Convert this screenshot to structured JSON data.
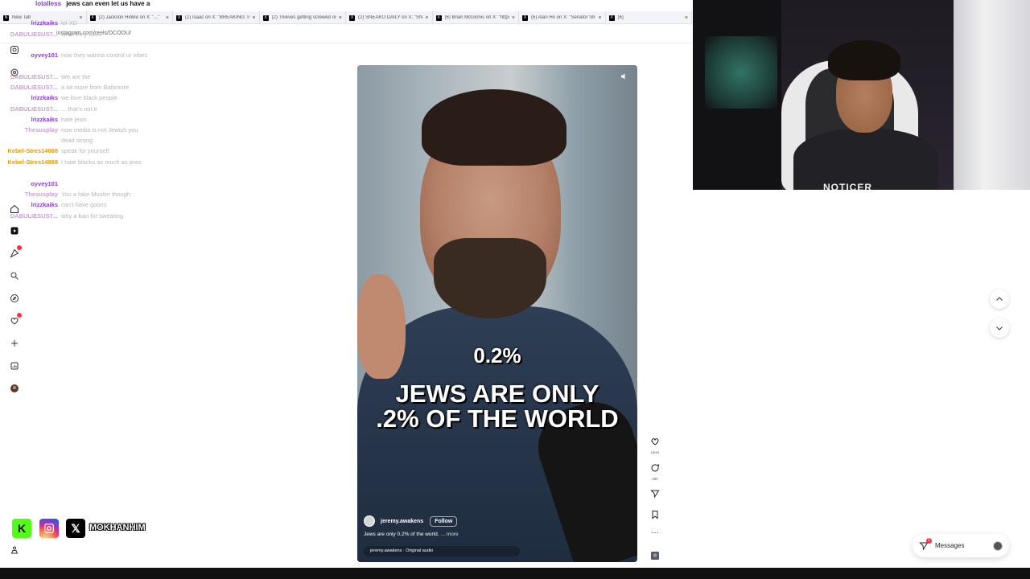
{
  "browser": {
    "tabs": [
      {
        "label": "New Tab",
        "icon": "N"
      },
      {
        "label": "(2) Jackson Hinkle on X: \"...\"",
        "icon": "X"
      },
      {
        "label": "(2) Isaac on X: \"BREAKING: Isra...",
        "icon": "X"
      },
      {
        "label": "(2) Thieves getting screwed on...",
        "icon": "X"
      },
      {
        "label": "(2) SNEAKO DAILY on X: \"SNEA...",
        "icon": "X"
      },
      {
        "label": "(6) Brian McGinnis on X: \"https...",
        "icon": "X"
      },
      {
        "label": "(6) Alan Ho on X: \"Senator Shed...",
        "icon": "X"
      },
      {
        "label": "(6)",
        "icon": "X"
      }
    ],
    "address": "instagram.com/reels/DCOOU/"
  },
  "chat": {
    "top": {
      "user": "lotalless",
      "message": "jews can even let us have a"
    },
    "lines": [
      {
        "user": "lrizzkaiks",
        "color": "#8a3fd1",
        "message": "lol XD"
      },
      {
        "user": "DABULIESUS7...",
        "color": "#c9a0d0",
        "message": "what they want"
      },
      {
        "user": "oyvey101",
        "color": "#8a3fd1",
        "message": "now they wanna control ur vibes"
      },
      {
        "user": "DABULIESUS7...",
        "color": "#c9a0d0",
        "message": "We are the"
      },
      {
        "user": "DABULIESUS7...",
        "color": "#c9a0d0",
        "message": "a lot more from Baltimore"
      },
      {
        "user": "lrizzkaiks",
        "color": "#8a3fd1",
        "message": "we love black people"
      },
      {
        "user": "DABULIESUS7...",
        "color": "#c9a0d0",
        "message": "... that's not it"
      },
      {
        "user": "lrizzkaiks",
        "color": "#8a3fd1",
        "message": "hate jews"
      },
      {
        "user": "Thesusplay",
        "color": "#c9a0d0",
        "message": "now media is not Jewish you dead wrong"
      },
      {
        "user": "Kebel-Stres14888",
        "color": "#e0a000",
        "message": "speak for yourself"
      },
      {
        "user": "Kebel-Stres14888",
        "color": "#e0a000",
        "message": "I hate blacks as much as jews"
      },
      {
        "user": "oyvey101",
        "color": "#8a3fd1",
        "message": ""
      },
      {
        "user": "Thesusplay",
        "color": "#c9a0d0",
        "message": "You a fake Muslim though"
      },
      {
        "user": "lrizzkaiks",
        "color": "#8a3fd1",
        "message": "can't have goons"
      },
      {
        "user": "DABULIESUS7...",
        "color": "#c9a0d0",
        "message": "why a ban for swearing"
      }
    ]
  },
  "reel": {
    "caption_small": "0.2%",
    "caption_big_1": "JEWS ARE ONLY",
    "caption_big_2": ".2% OF THE WORLD",
    "author": "jeremy.awakens",
    "follow_label": "Follow",
    "description": "Jews are only 0.2% of the world.",
    "more_label": "... more",
    "audio": "jeremy.awakens · Original audio"
  },
  "actions": {
    "likes": "Likes",
    "comments": "295"
  },
  "messages": {
    "label": "Messages",
    "badge": "1"
  },
  "webcam": {
    "hoodie_text": "NOTICER"
  },
  "overlay": {
    "handle": "MOKHANHIM",
    "kick_letter": "K",
    "x_letter": "𝕏"
  },
  "colors": {
    "accent_red": "#ff3040",
    "kick_green": "#53fc18"
  }
}
